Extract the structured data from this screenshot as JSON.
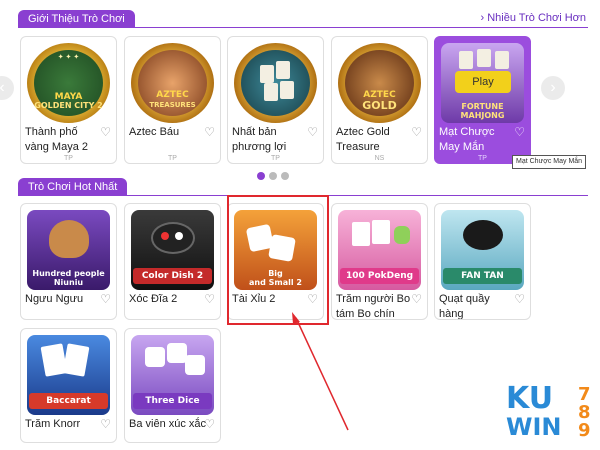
{
  "section1": {
    "title": "Giới Thiệu Trò Chơi",
    "more_link": "Nhiều Trò Chơi Hơn",
    "play_label": "Play",
    "tooltip": "Mạt Chược May Mắn",
    "games": [
      {
        "name": "Thành phố vàng Maya 2",
        "provider": "TP",
        "art_text": "MAYA GOLDEN CITY 2"
      },
      {
        "name": "Aztec Báu",
        "provider": "TP",
        "art_text": "AZTEC TREASURES"
      },
      {
        "name": "Nhất bản phương lợi",
        "provider": "TP",
        "art_text": ""
      },
      {
        "name": "Aztec Gold Treasure",
        "provider": "NS",
        "art_text": "AZTEC GOLD"
      },
      {
        "name": "Mạt Chược May Mắn",
        "provider": "TP",
        "art_text": "FORTUNE MAHJONG"
      }
    ]
  },
  "section2": {
    "title": "Trò Chơi Hot Nhất",
    "games": [
      {
        "name": "Ngưu Ngưu",
        "art_text": "Hundred people Niuniu"
      },
      {
        "name": "Xóc Đĩa 2",
        "art_text": "Color Dish 2"
      },
      {
        "name": "Tài Xỉu 2",
        "art_text": "Big and Small 2"
      },
      {
        "name": "Trăm người Bo tám Bo chín",
        "art_text": "100 PokDeng"
      },
      {
        "name": "Quạt quầy hàng",
        "art_text": "FAN TAN"
      },
      {
        "name": "Trăm Knorr",
        "art_text": "Baccarat"
      },
      {
        "name": "Ba viên xúc xắc",
        "art_text": "Three Dice"
      }
    ]
  },
  "logo": {
    "line1": "KU",
    "line2": "WIN",
    "digits": "789"
  },
  "colors": {
    "accent": "#8a3fd1",
    "highlight": "#e0282e"
  }
}
